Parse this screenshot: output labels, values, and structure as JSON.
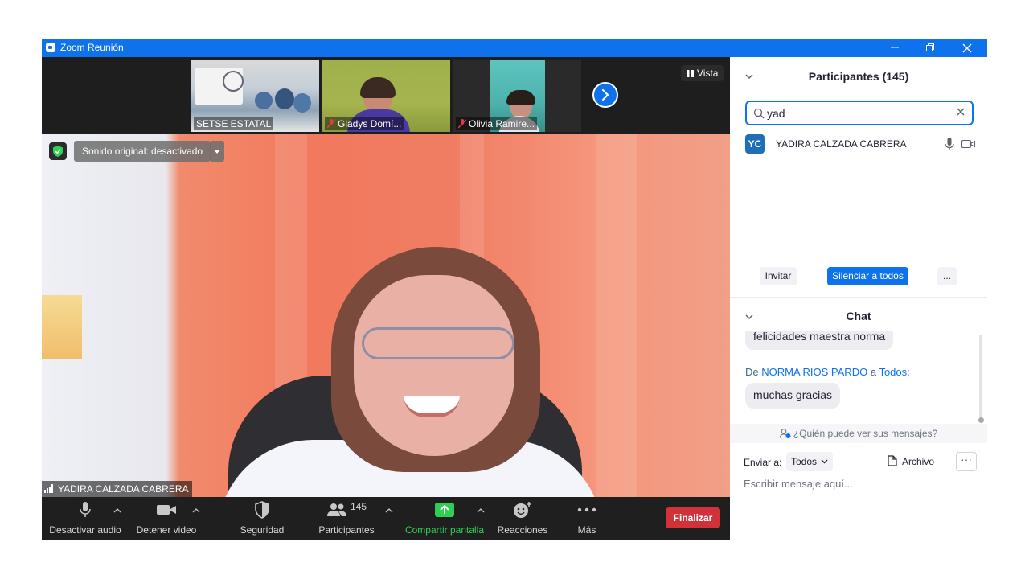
{
  "window": {
    "title": "Zoom Reunión"
  },
  "thumbnails": [
    {
      "name": "SETSE ESTATAL",
      "muted": false
    },
    {
      "name": "Gladys Domí...",
      "muted": true
    },
    {
      "name": "Olivia Ramire...",
      "muted": true
    }
  ],
  "view_label": "Vista",
  "sound_label": "Sonido original: desactivado",
  "active_speaker": "YADIRA CALZADA CABRERA",
  "toolbar": {
    "audio": "Desactivar audio",
    "video": "Detener video",
    "security": "Seguridad",
    "participants": "Participantes",
    "participants_count": "145",
    "share": "Compartir pantalla",
    "reactions": "Reacciones",
    "more": "Más",
    "end": "Finalizar"
  },
  "participants_panel": {
    "title": "Participantes (145)",
    "search_value": "yad",
    "participant": {
      "initials": "YC",
      "name": "YADIRA CALZADA CABRERA"
    },
    "invite": "Invitar",
    "mute_all": "Silenciar a todos",
    "more": "..."
  },
  "chat": {
    "title": "Chat",
    "message_1": "felicidades maestra norma",
    "from_prefix": "De",
    "from_name": "NORMA RIOS PARDO",
    "to_word": "a",
    "to_name": "Todos:",
    "message_2": "muchas gracias",
    "who_can_see": "¿Quién puede ver sus mensajes?",
    "send_to_label": "Enviar a:",
    "send_to_value": "Todos",
    "file_label": "Archivo",
    "input_placeholder": "Escribir mensaje aquí..."
  },
  "colors": {
    "accent": "#0e72ed",
    "end": "#d1323a",
    "share": "#2ed053",
    "toolbar": "#1f1f1f"
  }
}
